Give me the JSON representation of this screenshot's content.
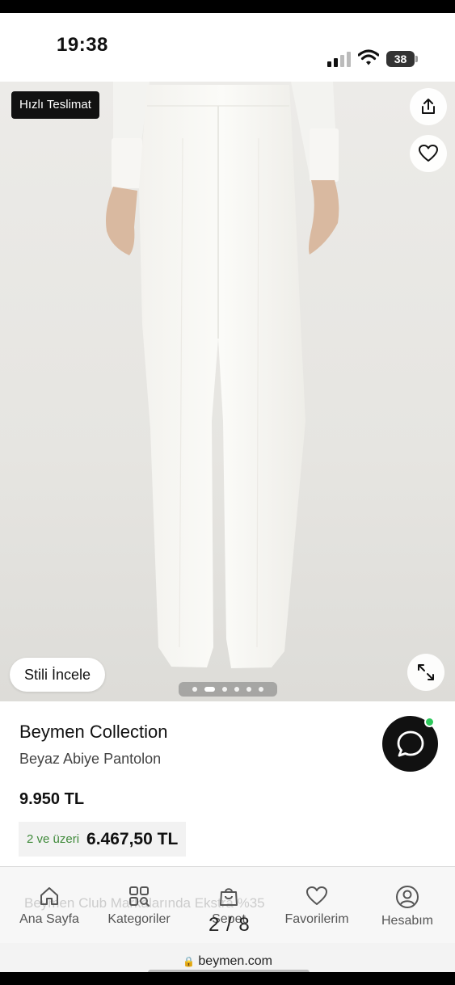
{
  "status_bar": {
    "time": "19:38",
    "battery": "38",
    "icons": [
      "cellular-signal-icon",
      "wifi-icon",
      "battery-icon"
    ]
  },
  "product_image": {
    "badge": "Hızlı Teslimat",
    "style_button": "Stili İncele",
    "carousel_dots": 6,
    "active_dot": 2,
    "icons": [
      "share-icon",
      "heart-icon",
      "expand-icon"
    ]
  },
  "product": {
    "brand": "Beymen Collection",
    "name": "Beyaz Abiye Pantolon",
    "price": "9.950 TL",
    "multi_buy_label": "2 ve üzeri",
    "multi_buy_price": "6.467,50 TL"
  },
  "tab_bar": {
    "items": [
      {
        "label": "Ana Sayfa",
        "icon": "home-icon"
      },
      {
        "label": "Kategoriler",
        "icon": "categories-icon"
      },
      {
        "label": "Sepet",
        "icon": "shopping-bag-icon"
      },
      {
        "label": "Favorilerim",
        "icon": "heart-icon"
      },
      {
        "label": "Hesabım",
        "icon": "account-icon"
      }
    ],
    "background_ghost_text": "Beymen Club Markalarında Ekstra %35",
    "page_indicator": "2 / 8"
  },
  "browser": {
    "url": "beymen.com"
  },
  "colors": {
    "accent_green": "#3f8a3a",
    "online_dot": "#2ec85c",
    "badge_bg": "#111111"
  }
}
